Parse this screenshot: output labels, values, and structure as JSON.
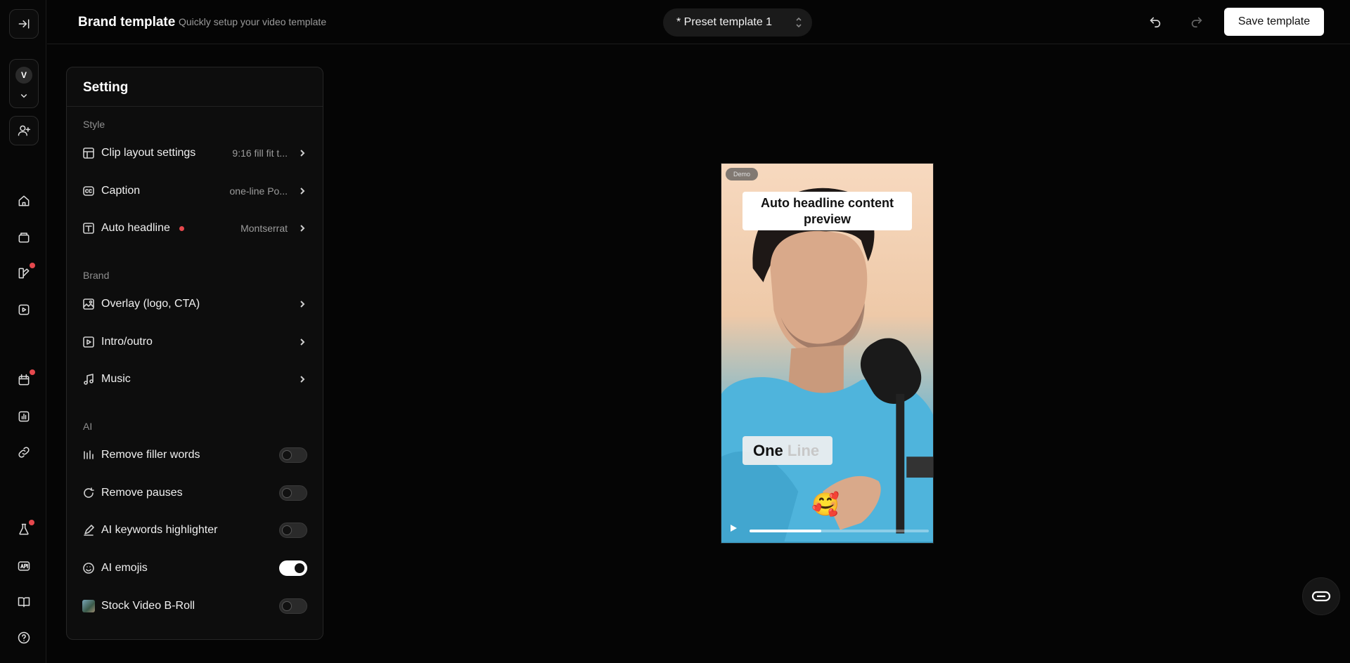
{
  "header": {
    "title": "Brand template",
    "subtitle": "Quickly setup your video template",
    "preset": "* Preset template 1",
    "save_label": "Save template"
  },
  "workspace": {
    "avatar_letter": "V"
  },
  "panel": {
    "title": "Setting",
    "sections": {
      "style": "Style",
      "brand": "Brand",
      "ai": "AI"
    },
    "style_rows": [
      {
        "label": "Clip layout settings",
        "value": "9:16 fill fit t...",
        "icon": "layout-icon"
      },
      {
        "label": "Caption",
        "value": "one-line Po...",
        "icon": "caption-icon"
      },
      {
        "label": "Auto headline",
        "value": "Montserrat",
        "icon": "headline-icon",
        "badge": true
      }
    ],
    "brand_rows": [
      {
        "label": "Overlay (logo, CTA)",
        "icon": "overlay-icon"
      },
      {
        "label": "Intro/outro",
        "icon": "intro-outro-icon"
      },
      {
        "label": "Music",
        "icon": "music-icon"
      }
    ],
    "ai_rows": [
      {
        "label": "Remove filler words",
        "icon": "filler-words-icon",
        "enabled": false
      },
      {
        "label": "Remove pauses",
        "icon": "pauses-icon",
        "enabled": false
      },
      {
        "label": "AI keywords highlighter",
        "icon": "highlighter-icon",
        "enabled": false
      },
      {
        "label": "AI emojis",
        "icon": "emoji-icon",
        "enabled": true
      },
      {
        "label": "Stock Video B-Roll",
        "icon": "broll-thumbnail-icon",
        "enabled": false
      }
    ]
  },
  "preview": {
    "badge": "Demo",
    "headline": "Auto headline content preview",
    "caption_word1": "One",
    "caption_word2": "Line",
    "emoji": "🥰",
    "progress": 0.4
  },
  "colors": {
    "background": "#050505",
    "panel": "#0d0d0d",
    "accent_dot": "#e5484d",
    "primary_button": "#ffffff"
  }
}
